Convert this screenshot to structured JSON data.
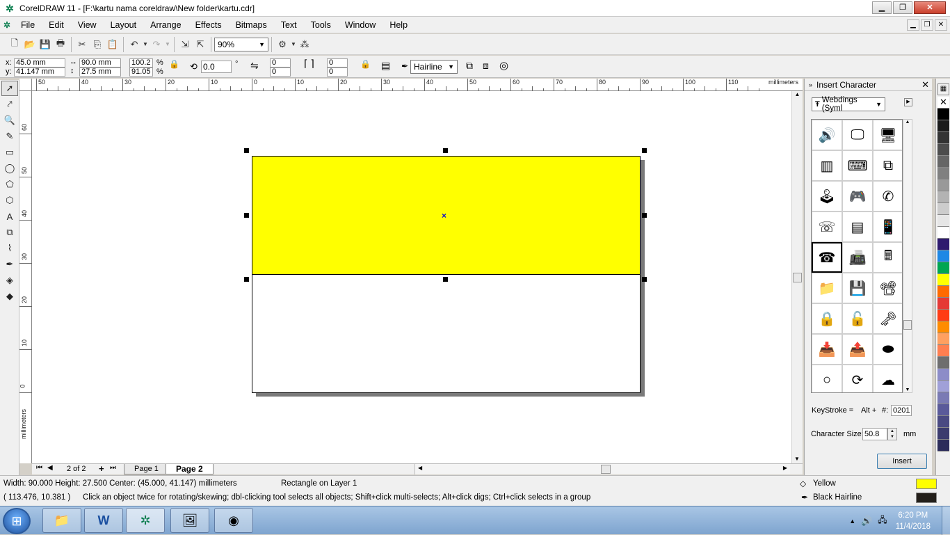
{
  "window": {
    "title": "CorelDRAW 11 - [F:\\kartu nama coreldraw\\New folder\\kartu.cdr]",
    "app_icon": "coreldraw-balloon-icon"
  },
  "menu": [
    "File",
    "Edit",
    "View",
    "Layout",
    "Arrange",
    "Effects",
    "Bitmaps",
    "Text",
    "Tools",
    "Window",
    "Help"
  ],
  "toolbar": {
    "zoom_value": "90%"
  },
  "properties": {
    "x_label": "x:",
    "x_value": "45.0 mm",
    "y_label": "y:",
    "y_value": "41.147 mm",
    "width_value": "90.0 mm",
    "height_value": "27.5 mm",
    "scale_x": "100.2",
    "scale_y": "91.05",
    "pct": "%",
    "rotation": "0.0",
    "deg": "°",
    "corner_tl": "0",
    "corner_bl": "0",
    "corner_tr": "0",
    "corner_br": "0",
    "outline": "Hairline"
  },
  "ruler": {
    "unit": "millimeters",
    "h_labels": [
      "50",
      "40",
      "30",
      "20",
      "10",
      "0",
      "10",
      "20",
      "30",
      "40",
      "50",
      "60",
      "70",
      "80",
      "90",
      "100",
      "110"
    ],
    "v_labels": [
      "60",
      "50",
      "40",
      "30",
      "20",
      "10",
      "0"
    ]
  },
  "pages": {
    "counter": "2 of 2",
    "tabs": [
      "Page 1",
      "Page 2"
    ],
    "active": "Page 2"
  },
  "insert_character": {
    "title": "Insert Character",
    "font": "Webdings (Syml",
    "keystroke_label": "KeyStroke =",
    "alt_label": "Alt +",
    "hash_label": "#:",
    "keystroke_value": "0201",
    "size_label": "Character Size:",
    "size_value": "50.8",
    "size_unit": "mm",
    "insert_button": "Insert"
  },
  "palette": [
    "#000000",
    "#1a1a1a",
    "#333333",
    "#4d4d4d",
    "#666666",
    "#808080",
    "#999999",
    "#b3b3b3",
    "#cccccc",
    "#e6e6e6",
    "#ffffff",
    "#2e1a6e",
    "#1e88e5",
    "#00a651",
    "#ffff00",
    "#ff6a00",
    "#e53935",
    "#ff3c14",
    "#ff8c00",
    "#ffa060",
    "#ff7f50",
    "#6e6e6e",
    "#8c8cc8",
    "#a0a0d8",
    "#7a7ab4",
    "#5a5a9a",
    "#4a4a82",
    "#3c3c6e",
    "#2c2c5a"
  ],
  "status": {
    "dims": "Width: 90.000  Height: 27.500  Center: (45.000, 41.147)  millimeters",
    "object": "Rectangle on Layer 1",
    "coords": "( 113.476, 10.381 )",
    "hint": "Click an object twice for rotating/skewing; dbl-clicking tool selects all objects; Shift+click multi-selects; Alt+click digs; Ctrl+click selects in a group",
    "fill_label": "Yellow",
    "fill_color": "#ffff00",
    "outline_label": "Black  Hairline",
    "outline_color": "#231f1a"
  },
  "taskbar": {
    "time": "6:20 PM",
    "date": "11/4/2018"
  }
}
